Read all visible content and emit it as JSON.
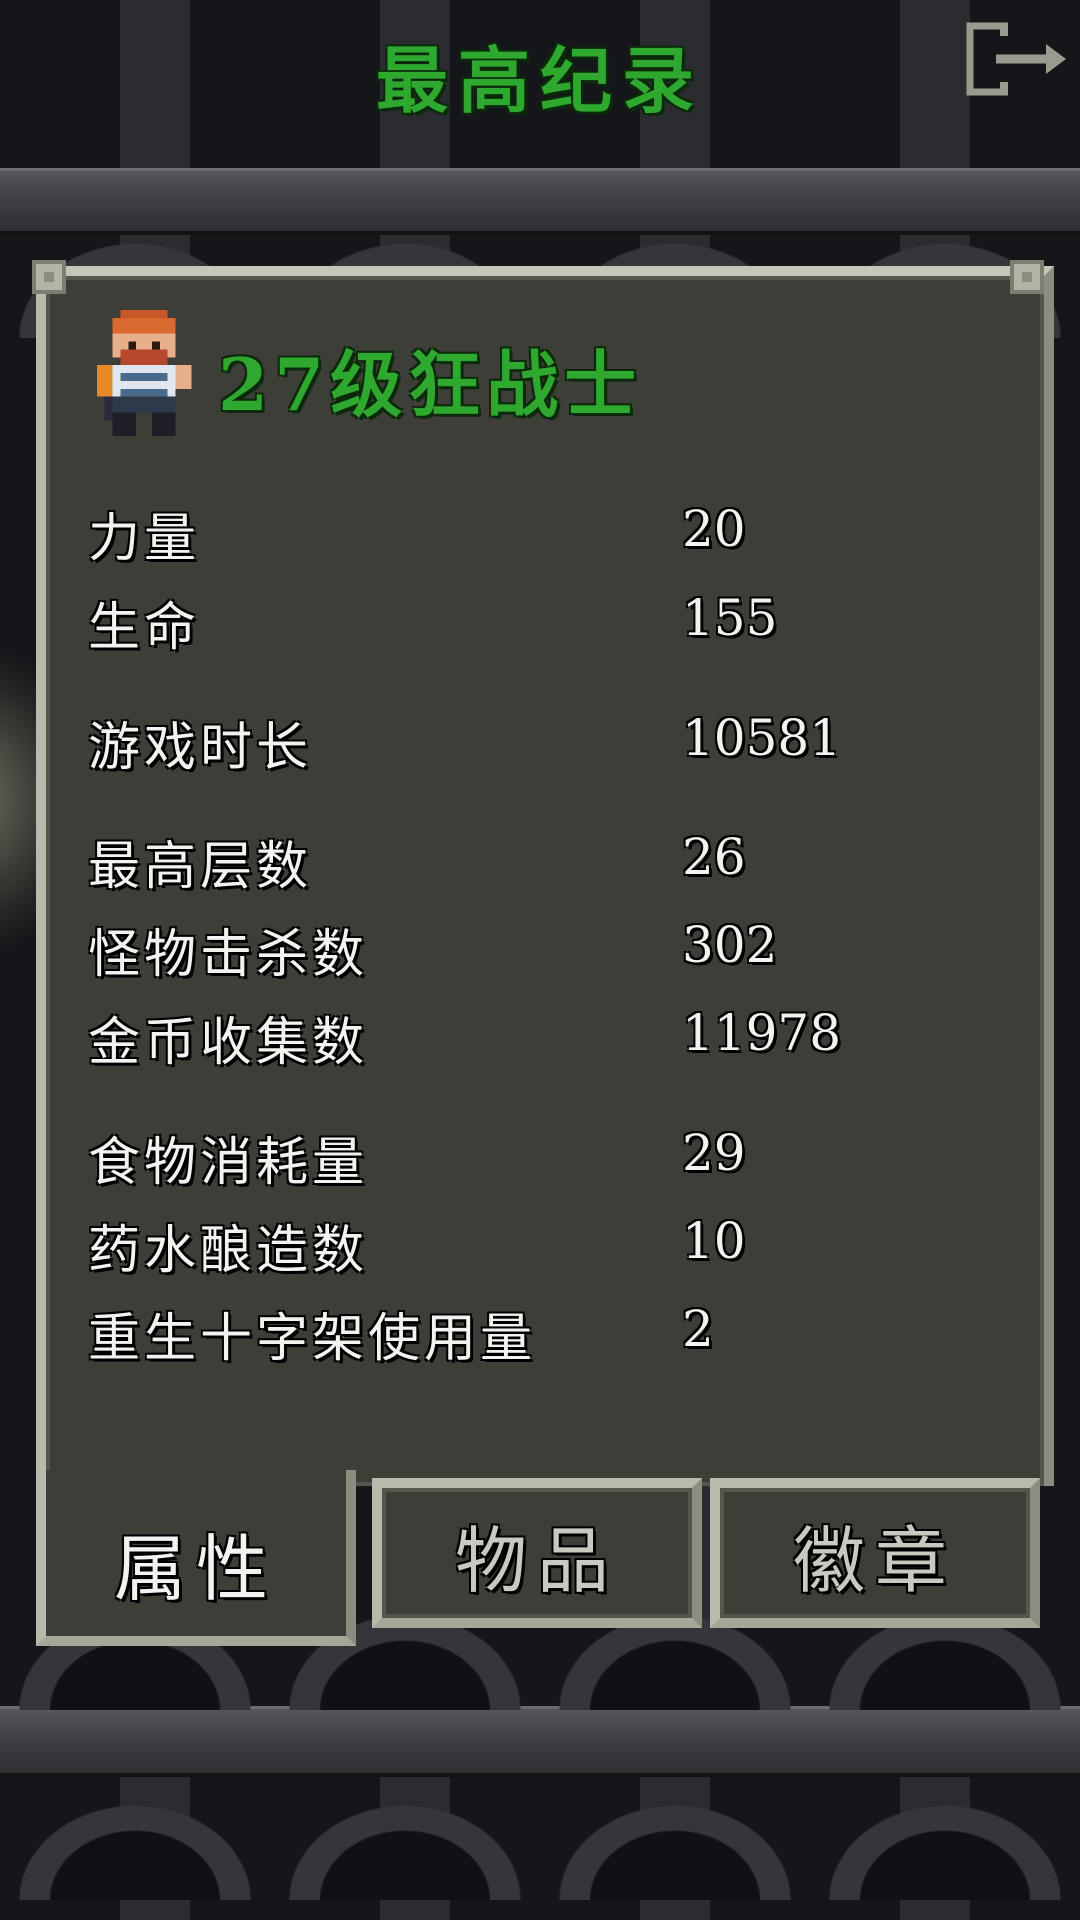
{
  "header": {
    "title": "最高纪录",
    "exit_icon": "exit-icon"
  },
  "hero": {
    "sprite_icon": "warrior-sprite-icon",
    "title": "27级狂战士"
  },
  "stats": [
    {
      "label": "力量",
      "value": "20"
    },
    {
      "label": "生命",
      "value": "155"
    },
    {
      "label": "游戏时长",
      "value": "10581"
    },
    {
      "label": "最高层数",
      "value": "26"
    },
    {
      "label": "怪物击杀数",
      "value": "302"
    },
    {
      "label": "金币收集数",
      "value": "11978"
    },
    {
      "label": "食物消耗量",
      "value": "29"
    },
    {
      "label": "药水酿造数",
      "value": "10"
    },
    {
      "label": "重生十字架使用量",
      "value": "2"
    }
  ],
  "tabs": [
    {
      "label": "属性",
      "active": true
    },
    {
      "label": "物品",
      "active": false
    },
    {
      "label": "徽章",
      "active": false
    }
  ],
  "colors": {
    "title_green": "#2fa82f",
    "panel_bg": "#3d3e37",
    "panel_border": "#a6a798",
    "text_white": "#f2f2ee",
    "tab_inactive_text": "#c9c9c2"
  }
}
